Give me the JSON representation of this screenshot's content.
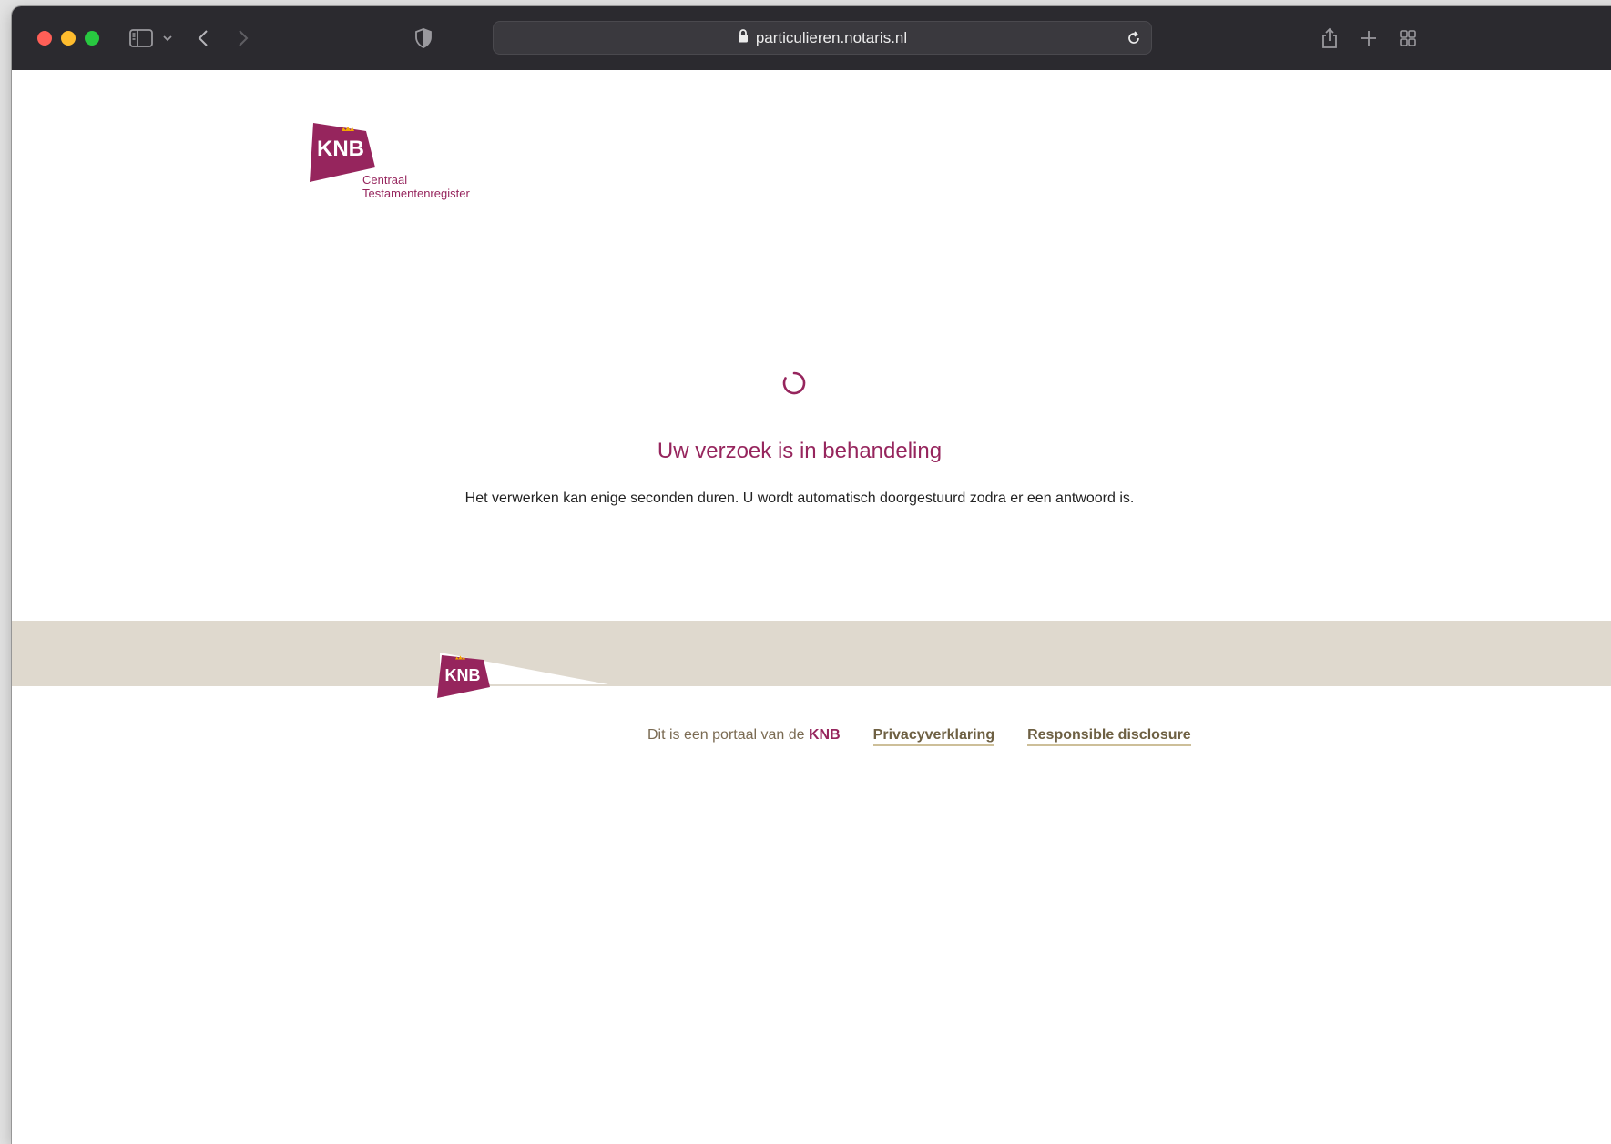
{
  "browser": {
    "url": "particulieren.notaris.nl"
  },
  "brand": {
    "logo_text": "KNB",
    "logo_subtitle_line1": "Centraal",
    "logo_subtitle_line2": "Testamentenregister",
    "accent_color": "#96255d"
  },
  "status": {
    "heading": "Uw verzoek is in behandeling",
    "message": "Het verwerken kan enige seconden duren. U wordt automatisch doorgestuurd zodra er een antwoord is."
  },
  "footer": {
    "logo_text": "KNB",
    "portal_text": "Dit is een portaal van de",
    "portal_brand": "KNB",
    "links": [
      {
        "label": "Privacyverklaring"
      },
      {
        "label": "Responsible disclosure"
      }
    ],
    "band_color": "#dfd9ce"
  }
}
